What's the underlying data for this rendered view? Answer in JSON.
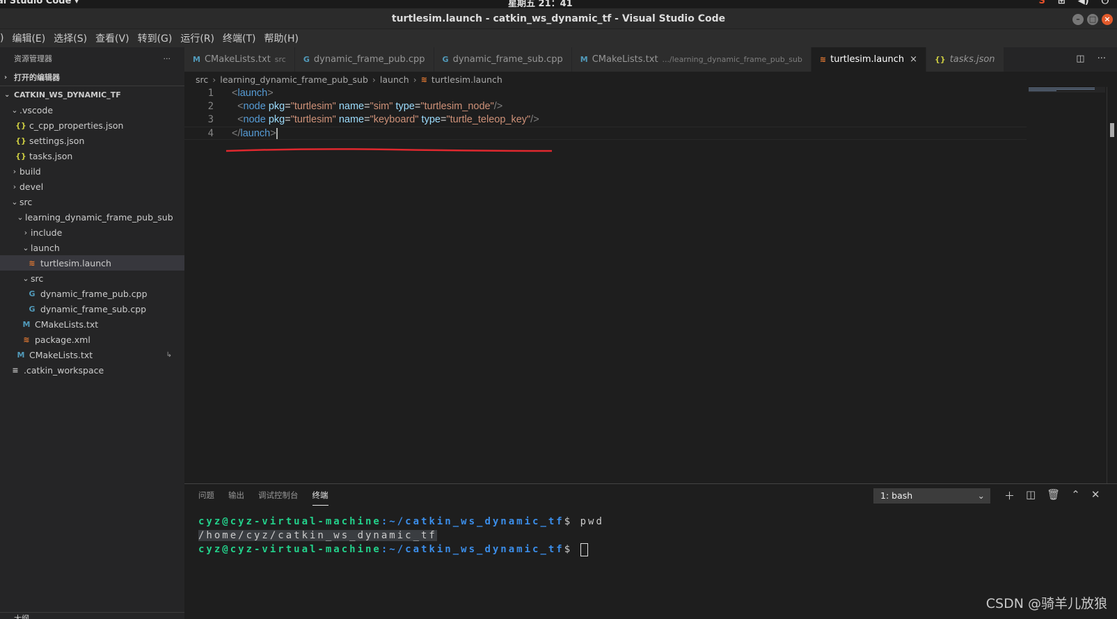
{
  "topbar": {
    "app_label": "al Studio Code ▾",
    "clock": "星期五 21：41"
  },
  "window": {
    "title": "turtlesim.launch - catkin_ws_dynamic_tf - Visual Studio Code"
  },
  "menu": {
    "items": [
      ")",
      "编辑(E)",
      "选择(S)",
      "查看(V)",
      "转到(G)",
      "运行(R)",
      "终端(T)",
      "帮助(H)"
    ]
  },
  "sidebar": {
    "header": "资源管理器",
    "more": "···",
    "open_editors": "打开的编辑器",
    "workspace": "CATKIN_WS_DYNAMIC_TF",
    "tree": [
      {
        "label": ".vscode",
        "type": "folder",
        "open": true,
        "depth": 1
      },
      {
        "label": "c_cpp_properties.json",
        "type": "json",
        "depth": 2
      },
      {
        "label": "settings.json",
        "type": "json",
        "depth": 2
      },
      {
        "label": "tasks.json",
        "type": "json",
        "depth": 2
      },
      {
        "label": "build",
        "type": "folder",
        "open": false,
        "depth": 1
      },
      {
        "label": "devel",
        "type": "folder",
        "open": false,
        "depth": 1
      },
      {
        "label": "src",
        "type": "folder",
        "open": true,
        "depth": 1
      },
      {
        "label": "learning_dynamic_frame_pub_sub",
        "type": "folder",
        "open": true,
        "depth": 2
      },
      {
        "label": "include",
        "type": "folder",
        "open": false,
        "depth": 3
      },
      {
        "label": "launch",
        "type": "folder",
        "open": true,
        "depth": 3
      },
      {
        "label": "turtlesim.launch",
        "type": "rss",
        "depth": 4,
        "active": true
      },
      {
        "label": "src",
        "type": "folder",
        "open": true,
        "depth": 3
      },
      {
        "label": "dynamic_frame_pub.cpp",
        "type": "cpp",
        "depth": 4
      },
      {
        "label": "dynamic_frame_sub.cpp",
        "type": "cpp",
        "depth": 4
      },
      {
        "label": "CMakeLists.txt",
        "type": "cmake",
        "depth": 3
      },
      {
        "label": "package.xml",
        "type": "rss",
        "depth": 3
      },
      {
        "label": "CMakeLists.txt",
        "type": "cmake",
        "depth": 2,
        "badge": "↳"
      },
      {
        "label": ".catkin_workspace",
        "type": "lines",
        "depth": 1
      }
    ],
    "outline": "大纲"
  },
  "tabs": [
    {
      "icon": "M",
      "icon_class": "ic-cmake",
      "label": "CMakeLists.txt",
      "desc": "src"
    },
    {
      "icon": "G",
      "icon_class": "ic-cpp",
      "label": "dynamic_frame_pub.cpp",
      "desc": ""
    },
    {
      "icon": "G",
      "icon_class": "ic-cpp",
      "label": "dynamic_frame_sub.cpp",
      "desc": ""
    },
    {
      "icon": "M",
      "icon_class": "ic-cmake",
      "label": "CMakeLists.txt",
      "desc": ".../learning_dynamic_frame_pub_sub"
    },
    {
      "icon": "≋",
      "icon_class": "ic-rss",
      "label": "turtlesim.launch",
      "desc": "",
      "active": true
    },
    {
      "icon": "{}",
      "icon_class": "ic-json",
      "label": "tasks.json",
      "desc": "",
      "italic": true
    }
  ],
  "breadcrumb": {
    "parts": [
      "src",
      "learning_dynamic_frame_pub_sub",
      "launch"
    ],
    "file": "turtlesim.launch"
  },
  "editor": {
    "lines": [
      {
        "n": "1",
        "tokens": [
          [
            "tag-b",
            "<"
          ],
          [
            "tag-n",
            "launch"
          ],
          [
            "tag-b",
            ">"
          ]
        ]
      },
      {
        "n": "2",
        "tokens": [
          [
            "",
            "  "
          ],
          [
            "tag-b",
            "<"
          ],
          [
            "tag-n",
            "node"
          ],
          [
            "",
            " "
          ],
          [
            "attr",
            "pkg"
          ],
          [
            "eq",
            "="
          ],
          [
            "val",
            "\"turtlesim\""
          ],
          [
            "",
            " "
          ],
          [
            "attr",
            "name"
          ],
          [
            "eq",
            "="
          ],
          [
            "val",
            "\"sim\""
          ],
          [
            "",
            " "
          ],
          [
            "attr",
            "type"
          ],
          [
            "eq",
            "="
          ],
          [
            "val",
            "\"turtlesim_node\""
          ],
          [
            "tag-b",
            "/>"
          ]
        ]
      },
      {
        "n": "3",
        "tokens": [
          [
            "",
            "  "
          ],
          [
            "tag-b",
            "<"
          ],
          [
            "tag-n",
            "node"
          ],
          [
            "",
            " "
          ],
          [
            "attr",
            "pkg"
          ],
          [
            "eq",
            "="
          ],
          [
            "val",
            "\"turtlesim\""
          ],
          [
            "",
            " "
          ],
          [
            "attr",
            "name"
          ],
          [
            "eq",
            "="
          ],
          [
            "val",
            "\"keyboard\""
          ],
          [
            "",
            " "
          ],
          [
            "attr",
            "type"
          ],
          [
            "eq",
            "="
          ],
          [
            "val",
            "\"turtle_teleop_key\""
          ],
          [
            "tag-b",
            "/>"
          ]
        ]
      },
      {
        "n": "4",
        "tokens": [
          [
            "tag-b",
            "</"
          ],
          [
            "tag-n",
            "launch"
          ],
          [
            "tag-b",
            ">"
          ]
        ],
        "cursor": true
      }
    ]
  },
  "panel": {
    "tabs": [
      "问题",
      "输出",
      "调试控制台",
      "终端"
    ],
    "active_tab": 3,
    "terminal_select": "1: bash",
    "terminal": {
      "prompt_user": "cyz@cyz-virtual-machine",
      "prompt_path": ":~/catkin_ws_dynamic_tf",
      "prompt_end": "$",
      "command": " pwd",
      "output": "/home/cyz/catkin_ws_dynamic_tf"
    }
  },
  "watermark": "CSDN @骑羊儿放狼",
  "colors": {
    "accent_red_annotation": "#e0282e",
    "terminal_user": "#23d18b",
    "terminal_path": "#3b8eea"
  }
}
